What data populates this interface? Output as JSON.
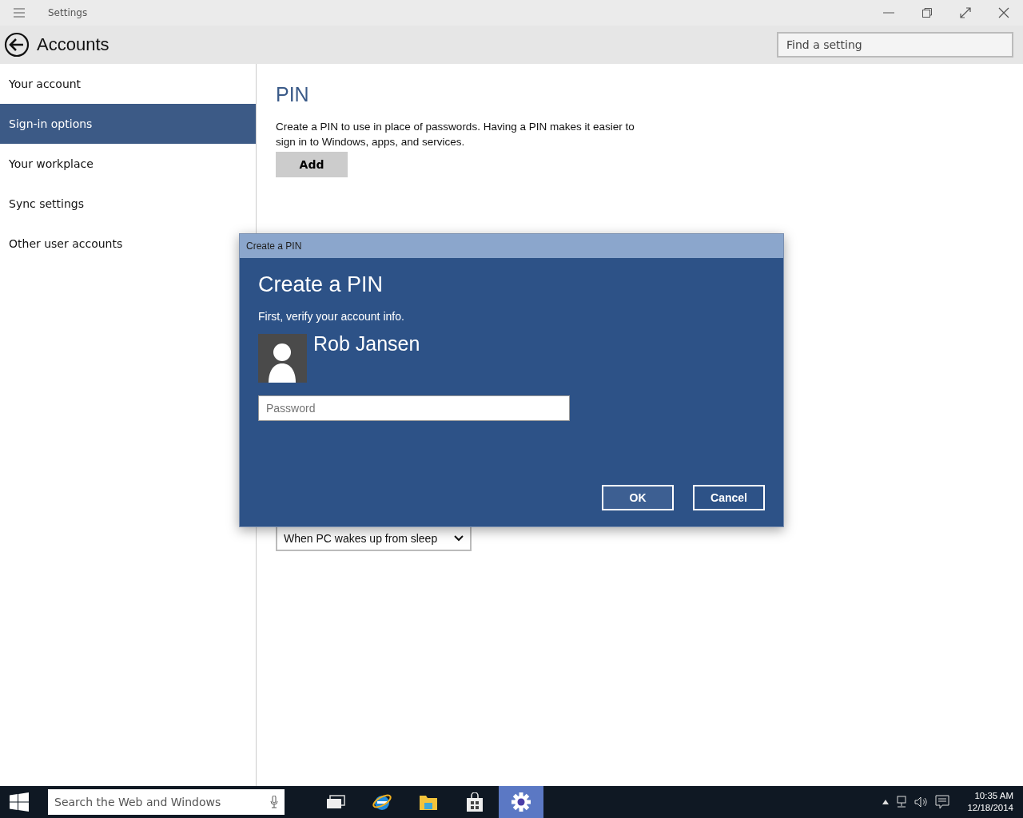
{
  "window": {
    "title": "Settings"
  },
  "header": {
    "title": "Accounts",
    "search": {
      "placeholder": "Find a setting"
    }
  },
  "sidebar": {
    "items": [
      {
        "label": "Your account",
        "selected": false
      },
      {
        "label": "Sign-in options",
        "selected": true
      },
      {
        "label": "Your workplace",
        "selected": false
      },
      {
        "label": "Sync settings",
        "selected": false
      },
      {
        "label": "Other user accounts",
        "selected": false
      }
    ]
  },
  "content": {
    "pin": {
      "heading": "PIN",
      "text": "Create a PIN to use in place of passwords. Having a PIN makes it easier to sign in to Windows, apps, and services.",
      "button": "Add"
    },
    "require_signin": {
      "value": "When PC wakes up from sleep"
    }
  },
  "dialog": {
    "title": "Create a PIN",
    "heading": "Create a PIN",
    "text": "First, verify your account info.",
    "user": "Rob Jansen",
    "password": {
      "placeholder": "Password"
    },
    "buttons": [
      {
        "label": "OK",
        "selected": true
      },
      {
        "label": "Cancel",
        "selected": false
      }
    ]
  },
  "taskbar": {
    "search": {
      "placeholder": "Search the Web and Windows"
    },
    "apps": [
      {
        "kind": "taskview",
        "selected": false
      },
      {
        "kind": "browser",
        "selected": false
      },
      {
        "kind": "folder",
        "selected": false
      },
      {
        "kind": "store",
        "selected": false
      },
      {
        "kind": "settings",
        "selected": true
      }
    ],
    "time": "10:35 AM",
    "date": "12/18/2014"
  }
}
